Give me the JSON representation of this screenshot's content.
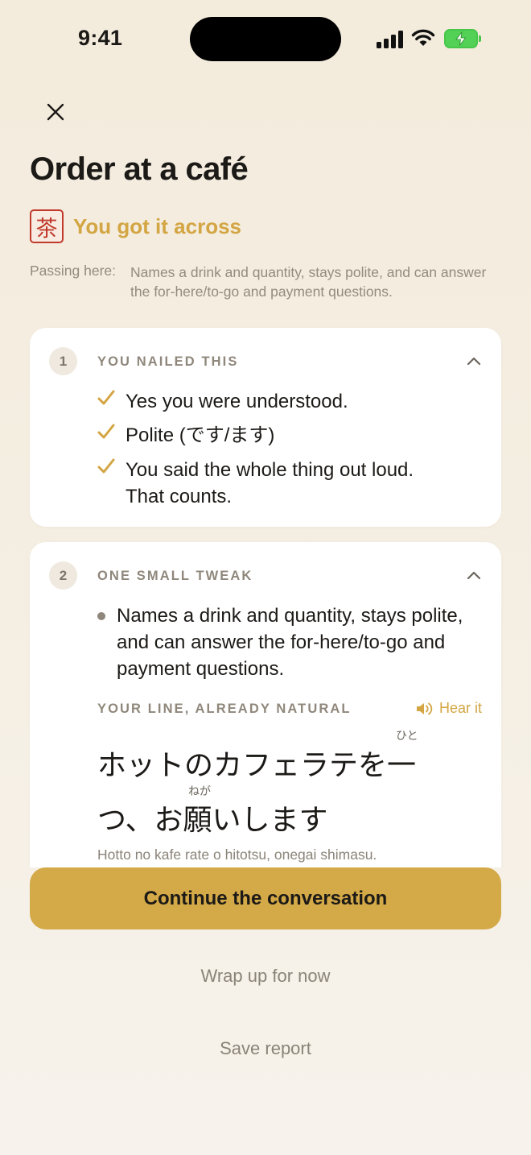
{
  "status_bar": {
    "time": "9:41",
    "icons": [
      "signal-icon",
      "wifi-icon",
      "battery-charging-icon"
    ]
  },
  "header": {
    "close_icon": "close-icon",
    "title": "Order at a café"
  },
  "result": {
    "seal_glyph": "茶",
    "text": "You got it across",
    "color": "#d3a543"
  },
  "passing": {
    "label": "Passing here:",
    "text": "Names a drink and quantity, stays polite, and can answer the for-here/to-go and payment questions."
  },
  "sections": [
    {
      "number": "1",
      "heading": "YOU NAILED THIS",
      "items": [
        "Yes you were understood.",
        "Polite (です/ます)",
        "You said the whole thing out loud. That counts."
      ]
    },
    {
      "number": "2",
      "heading": "ONE SMALL TWEAK",
      "bullet": "Names a drink and quantity, stays polite, and can answer the for-here/to-go and payment questions.",
      "natural_label": "YOUR LINE, ALREADY NATURAL",
      "hear_label": "Hear it",
      "jp_line1": "ホットのカフェラテを一",
      "jp_line2": "つ、お願いします",
      "ruby_hito": "ひと",
      "ruby_nega": "ねが",
      "romaji": "Hotto no kafe rate o hitotsu, onegai shimasu."
    }
  ],
  "actions": {
    "continue": "Continue the conversation",
    "wrap_up": "Wrap up for now",
    "save": "Save report"
  },
  "colors": {
    "accent": "#d4a947",
    "seal": "#c0392b",
    "background": "#f3ebdc",
    "check": "#d3a543"
  }
}
